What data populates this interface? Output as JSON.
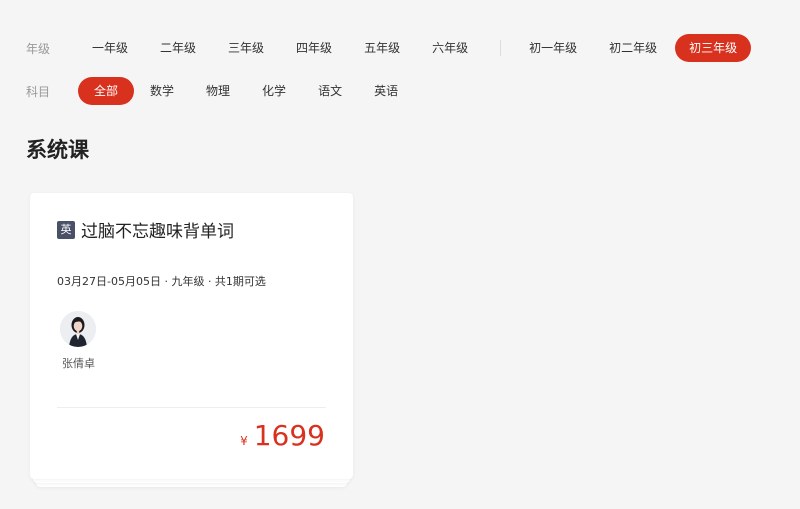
{
  "filters": {
    "grade_label": "年级",
    "grades": [
      "一年级",
      "二年级",
      "三年级",
      "四年级",
      "五年级",
      "六年级"
    ],
    "grades_secondary": [
      "初一年级",
      "初二年级",
      "初三年级"
    ],
    "active_grade": "初三年级",
    "subject_label": "科目",
    "subjects": [
      "全部",
      "数学",
      "物理",
      "化学",
      "语文",
      "英语"
    ],
    "active_subject": "全部"
  },
  "section": {
    "title": "系统课"
  },
  "course": {
    "subject_tag": "英",
    "title": "过脑不忘趣味背单词",
    "meta": "03月27日-05月05日 · 九年级 · 共1期可选",
    "teacher": "张倩卓",
    "price_symbol": "¥",
    "price": "1699"
  },
  "colors": {
    "accent": "#d8321e",
    "tag_bg": "#4a5068"
  }
}
